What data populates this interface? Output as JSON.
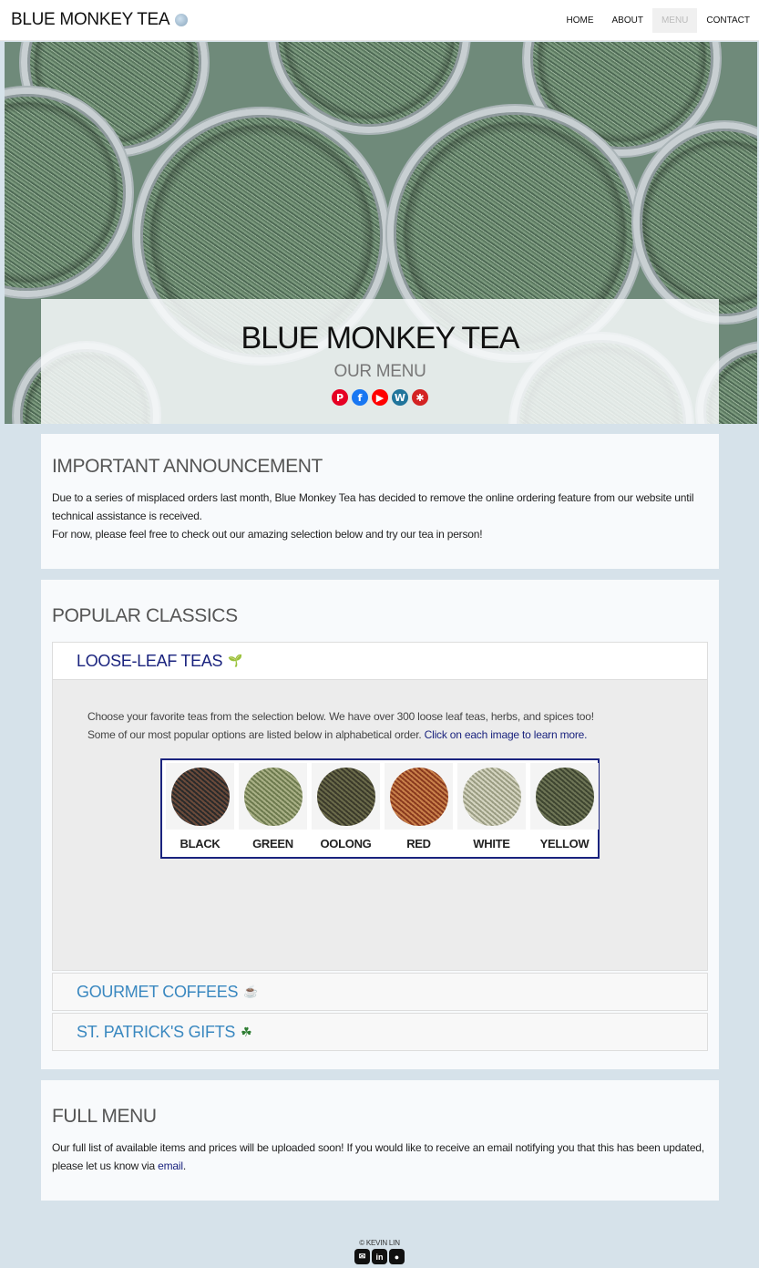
{
  "navbar": {
    "brand": "BLUE MONKEY TEA",
    "links": [
      "HOME",
      "ABOUT",
      "MENU",
      "CONTACT"
    ],
    "active": "MENU"
  },
  "hero": {
    "title": "BLUE MONKEY TEA",
    "subtitle": "OUR MENU",
    "social": [
      {
        "name": "pinterest-icon",
        "glyph": "P",
        "color": "#e60023"
      },
      {
        "name": "facebook-icon",
        "glyph": "f",
        "color": "#1877f2"
      },
      {
        "name": "youtube-icon",
        "glyph": "▶",
        "color": "#ff0000"
      },
      {
        "name": "wordpress-icon",
        "glyph": "W",
        "color": "#21759b"
      },
      {
        "name": "yelp-icon",
        "glyph": "✱",
        "color": "#d32323"
      }
    ]
  },
  "announcement": {
    "heading": "IMPORTANT ANNOUNCEMENT",
    "line1": "Due to a series of misplaced orders last month, Blue Monkey Tea has decided to remove the online ordering feature from our website until technical assistance is received.",
    "line2": "For now, please feel free to check out our amazing selection below and try our tea in person!"
  },
  "popular": {
    "heading": "POPULAR CLASSICS",
    "loose_leaf": {
      "title": "LOOSE-LEAF TEAS",
      "emoji": "🌱",
      "text1": "Choose your favorite teas from the selection below. We have over 300 loose leaf teas, herbs, and spices too!",
      "text2": "Some of our most popular options are listed below in alphabetical order.",
      "link": "Click on each image to learn more.",
      "teas": [
        {
          "label": "BLACK",
          "c1": "#2a2a2a",
          "c2": "#6b4a3a"
        },
        {
          "label": "GREEN",
          "c1": "#6d7a4e",
          "c2": "#a9b086"
        },
        {
          "label": "OOLONG",
          "c1": "#3b3a2a",
          "c2": "#6a6a4a"
        },
        {
          "label": "RED",
          "c1": "#8a3a1e",
          "c2": "#c8804a"
        },
        {
          "label": "WHITE",
          "c1": "#9a9c82",
          "c2": "#d4d4c0"
        },
        {
          "label": "YELLOW",
          "c1": "#3e4530",
          "c2": "#6e7556"
        }
      ]
    },
    "coffees": {
      "title": "GOURMET COFFEES",
      "emoji": "☕"
    },
    "gifts": {
      "title": "ST. PATRICK'S GIFTS",
      "emoji": "☘"
    }
  },
  "fullmenu": {
    "heading": "FULL MENU",
    "text": "Our full list of available items and prices will be uploaded soon! If you would like to receive an email notifying you that this has been updated, please let us know via ",
    "link": "email",
    "end": "."
  },
  "footer": {
    "copyright": "© KEVIN LIN",
    "icons": [
      {
        "name": "email-icon",
        "glyph": "✉"
      },
      {
        "name": "linkedin-icon",
        "glyph": "in"
      },
      {
        "name": "github-icon",
        "glyph": "●"
      }
    ]
  }
}
